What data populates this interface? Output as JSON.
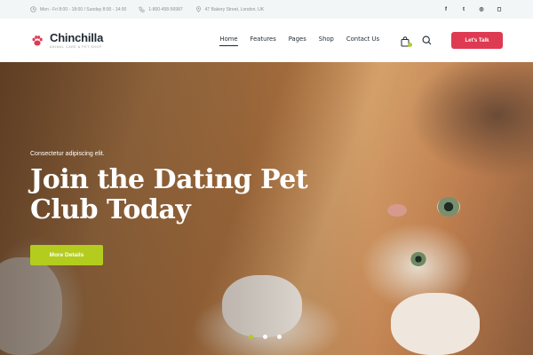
{
  "topbar": {
    "hours": "Mon - Fri 8:00 - 18:00 / Sunday 8:00 - 14:00",
    "phone": "1-800-458-56987",
    "address": "47 Bakery Street, London, UK",
    "socials": [
      {
        "icon": "facebook-icon",
        "glyph": "f"
      },
      {
        "icon": "twitter-icon",
        "glyph": "t"
      },
      {
        "icon": "dribbble-icon",
        "glyph": "◎"
      },
      {
        "icon": "instagram-icon",
        "glyph": "◻"
      }
    ]
  },
  "header": {
    "logo_name": "Chinchilla",
    "logo_tagline": "ANIMAL CARE & PET SHOP",
    "nav": [
      {
        "label": "Home",
        "active": true
      },
      {
        "label": "Features",
        "active": false
      },
      {
        "label": "Pages",
        "active": false
      },
      {
        "label": "Shop",
        "active": false
      },
      {
        "label": "Contact Us",
        "active": false
      }
    ],
    "cta_label": "Let's Talk"
  },
  "hero": {
    "subtitle": "Consectetur adipiscing elit.",
    "title": "Join the Dating Pet Club Today",
    "button_label": "More Details",
    "slides": 3,
    "active_slide": 0
  },
  "colors": {
    "accent_red": "#de3a52",
    "accent_green": "#b3cc1e",
    "dark": "#1d2830"
  }
}
